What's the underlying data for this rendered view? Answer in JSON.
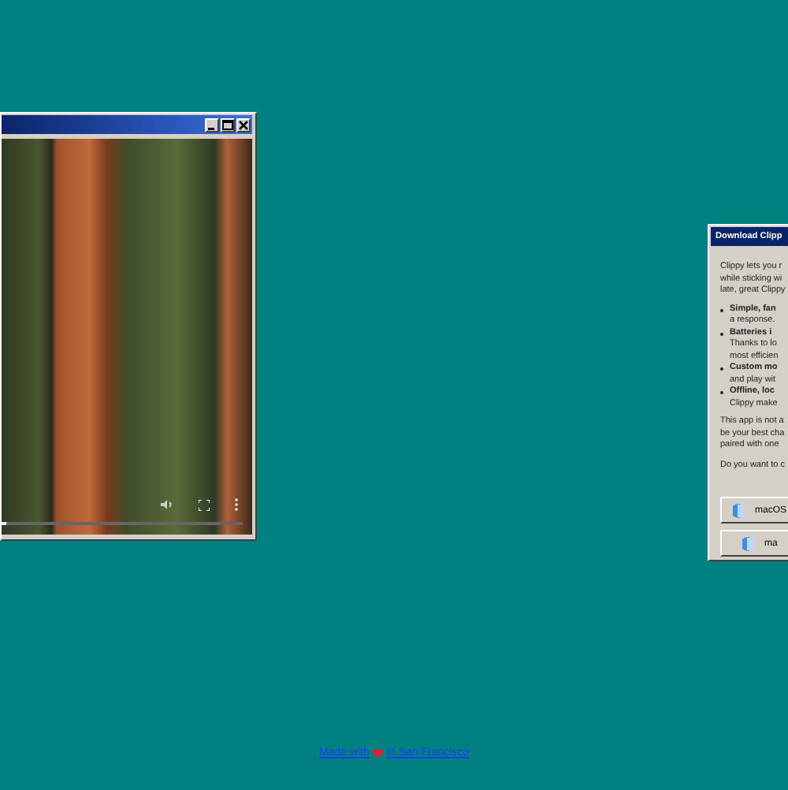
{
  "video_window": {
    "controls": {
      "level": 0.02
    }
  },
  "download_window": {
    "title": "Download Clipp",
    "intro": [
      "Clippy lets you r",
      "while sticking wi",
      "late, great Clippy"
    ],
    "features": [
      {
        "title": "Simple, fan",
        "lines": [
          "a response."
        ]
      },
      {
        "title": "Batteries i",
        "lines": [
          "Thanks to lo",
          "most efficien"
        ]
      },
      {
        "title": "Custom mo",
        "lines": [
          "and play wit"
        ]
      },
      {
        "title": "Offline, loc",
        "lines": [
          "Clippy make"
        ]
      }
    ],
    "notice": [
      "This app is not a",
      "be your best cha",
      "paired with one"
    ],
    "question": "Do you want to c",
    "buttons": [
      "macOS",
      "ma"
    ]
  },
  "footer": {
    "link_before": "Made with",
    "link_after": "in San Francisco"
  }
}
